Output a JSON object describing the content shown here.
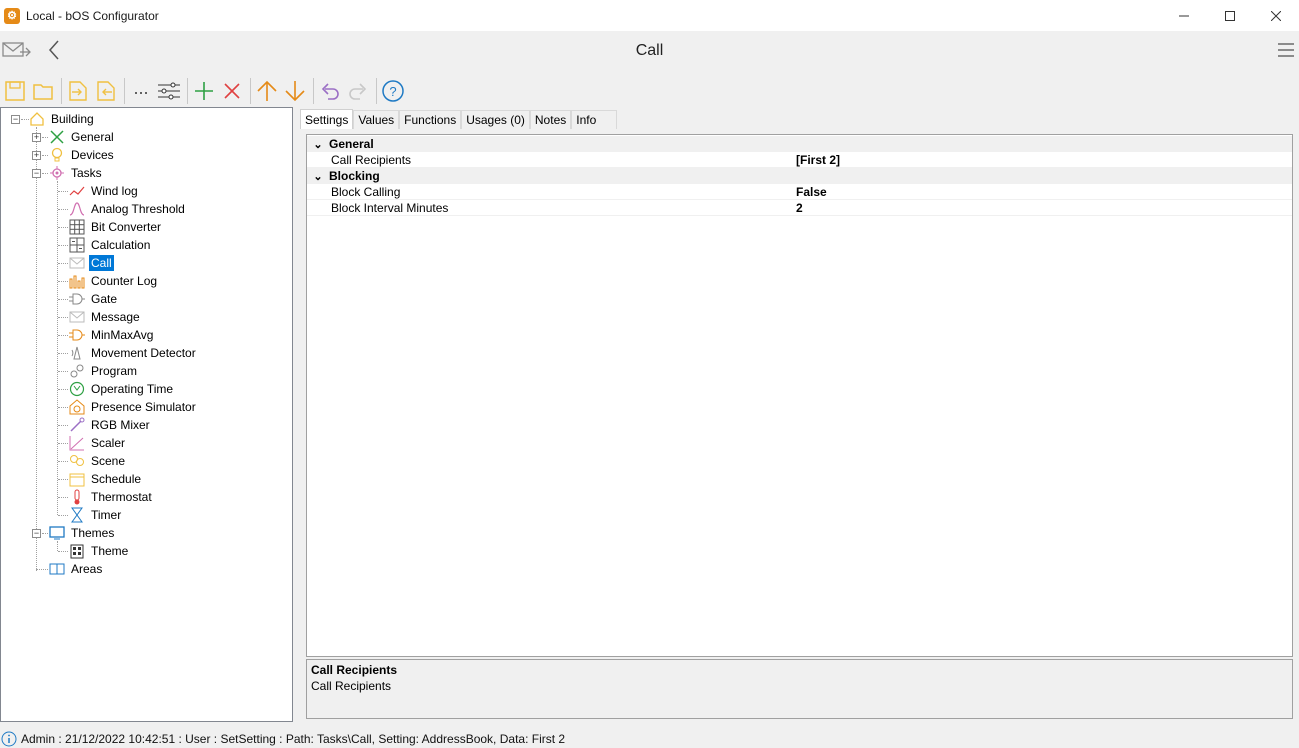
{
  "window": {
    "title": "Local - bOS Configurator"
  },
  "nav": {
    "title": "Call"
  },
  "tree": {
    "root": "Building",
    "general": "General",
    "devices": "Devices",
    "tasks": "Tasks",
    "task_items": [
      "Wind log",
      "Analog Threshold",
      "Bit Converter",
      "Calculation",
      "Call",
      "Counter Log",
      "Gate",
      "Message",
      "MinMaxAvg",
      "Movement Detector",
      "Program",
      "Operating Time",
      "Presence Simulator",
      "RGB Mixer",
      "Scaler",
      "Scene",
      "Schedule",
      "Thermostat",
      "Timer"
    ],
    "themes": "Themes",
    "theme": "Theme",
    "areas": "Areas"
  },
  "tabs": [
    "Settings",
    "Values",
    "Functions",
    "Usages (0)",
    "Notes",
    "Info"
  ],
  "properties": {
    "general": {
      "label": "General",
      "call_recipients": {
        "name": "Call Recipients",
        "value": "[First 2]"
      }
    },
    "blocking": {
      "label": "Blocking",
      "block_calling": {
        "name": "Block Calling",
        "value": "False"
      },
      "block_interval": {
        "name": "Block Interval Minutes",
        "value": "2"
      }
    }
  },
  "description": {
    "title": "Call Recipients",
    "text": "Call Recipients"
  },
  "status": {
    "text": "Admin : 21/12/2022 10:42:51 : User : SetSetting : Path: Tasks\\Call, Setting: AddressBook, Data: First 2"
  },
  "colors": {
    "accent": "#0078d7",
    "orange": "#e58a17",
    "yellow": "#f0c040",
    "green": "#2ea043",
    "red": "#e04040"
  }
}
